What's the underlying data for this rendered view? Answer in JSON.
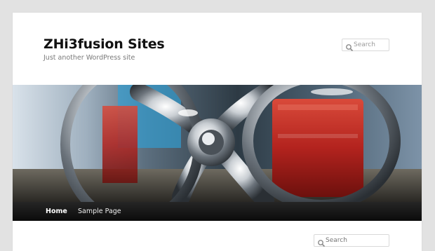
{
  "site": {
    "title": "ZHi3fusion Sites",
    "description": "Just another WordPress site"
  },
  "search": {
    "placeholder": "Search"
  },
  "nav": {
    "items": [
      {
        "label": "Home",
        "current": true
      },
      {
        "label": "Sample Page",
        "current": false
      }
    ]
  },
  "sidebar": {
    "search": {
      "placeholder": "Search"
    }
  },
  "colors": {
    "page_background": "#e2e2e2",
    "nav_background": "#0b0b0b",
    "title_color": "#111111",
    "header_red": "#b3231e"
  }
}
